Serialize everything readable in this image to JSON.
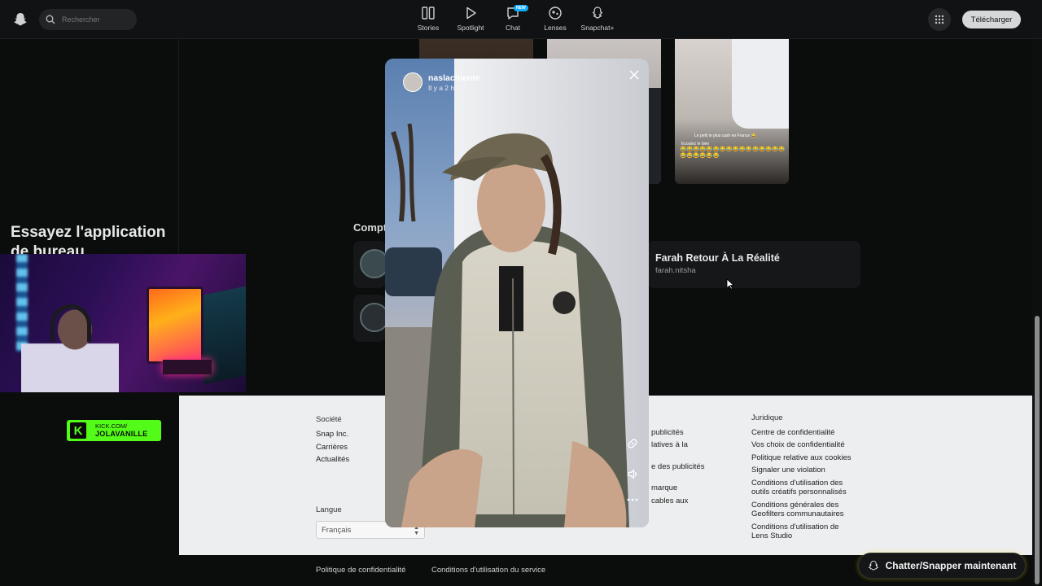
{
  "topbar": {
    "search_placeholder": "Rechercher",
    "nav": [
      {
        "label": "Stories",
        "icon": "stories-icon"
      },
      {
        "label": "Spotlight",
        "icon": "play-icon"
      },
      {
        "label": "Chat",
        "icon": "chat-icon",
        "badge": "NEW"
      },
      {
        "label": "Lenses",
        "icon": "lens-icon"
      },
      {
        "label": "Snapchat+",
        "icon": "ghost-plus-icon"
      }
    ],
    "download_label": "Télécharger"
  },
  "sidebar": {
    "promo": "Essayez l'application de bureau"
  },
  "accounts": {
    "title": "Compt",
    "items": [
      {
        "name": "Farah Retour À La Réalité",
        "handle": "farah.nitsha"
      }
    ]
  },
  "thumbs": {
    "caption_line1": "Le petit le plus cash en France 😂",
    "caption_line2": "Ecoutez le bien",
    "emoji_row": "😂😂😂😂😂😂😂😂😂😂😂😂😂😂😂😂😂😂😂😂😂😂"
  },
  "story": {
    "author": "naslachiente",
    "time": "Il y a 2 h"
  },
  "footer": {
    "company": {
      "title": "Société",
      "links": [
        "Snap Inc.",
        "Carrières",
        "Actualités"
      ]
    },
    "middle": {
      "links": [
        "publicités",
        "latives à la",
        "e des publicités",
        "marque",
        "cables aux"
      ]
    },
    "legal": {
      "title": "Juridique",
      "links": [
        "Centre de confidentialité",
        "Vos choix de confidentialité",
        "Politique relative aux cookies",
        "Signaler une violation",
        "Conditions d'utilisation des outils créatifs personnalisés",
        "Conditions générales des Geofilters communautaires",
        "Conditions d'utilisation de Lens Studio"
      ]
    },
    "language_label": "Langue",
    "language_value": "Français"
  },
  "bottom": {
    "privacy": "Politique de confidentialité",
    "terms": "Conditions d'utilisation du service",
    "chat_now": "Chatter/Snapper maintenant"
  },
  "kick": {
    "line1": "KICK.COM/",
    "line2": "JOLAVANILLE"
  },
  "colors": {
    "kick_green": "#53fc18",
    "snap_yellow": "#fffc00",
    "badge_blue": "#0fadff"
  }
}
